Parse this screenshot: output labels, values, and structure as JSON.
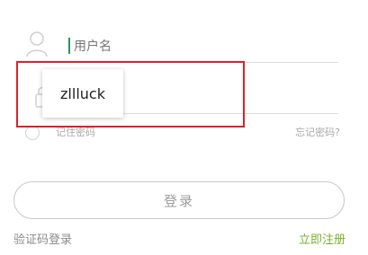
{
  "colors": {
    "accent_green": "#7bb02a",
    "caret_green": "#2f8f62",
    "highlight_red": "#e0202a",
    "placeholder_gray": "#b7b7b7",
    "border_gray": "#c8c8c8"
  },
  "icons": {
    "user": "user-icon",
    "lock": "lock-icon"
  },
  "form": {
    "username_placeholder": "用户名",
    "remember_label": "记住密码",
    "forgot_label": "忘记密码?",
    "login_label": "登录",
    "sms_login_label": "验证码登录",
    "register_label": "立即注册"
  },
  "autofill": {
    "suggestion": "zllluck"
  }
}
